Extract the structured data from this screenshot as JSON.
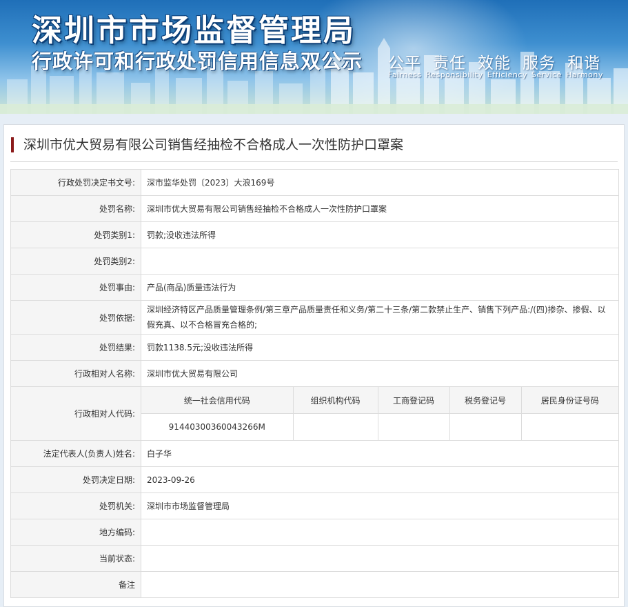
{
  "banner": {
    "title": "深圳市市场监督管理局",
    "subtitle": "行政许可和行政处罚信用信息双公示",
    "slogans": [
      "公平",
      "责任",
      "效能",
      "服务",
      "和谐"
    ],
    "slogans_en": [
      "Fairness",
      "Responsibility",
      "Efficiency",
      "Service",
      "Harmony"
    ]
  },
  "case_title": "深圳市优大贸易有限公司销售经抽检不合格成人一次性防护口罩案",
  "rows": {
    "doc_no": {
      "label": "行政处罚决定书文号:",
      "value": "深市监华处罚〔2023〕大浪169号"
    },
    "name": {
      "label": "处罚名称:",
      "value": "深圳市优大贸易有限公司销售经抽检不合格成人一次性防护口罩案"
    },
    "cat1": {
      "label": "处罚类别1:",
      "value": "罚款;没收违法所得"
    },
    "cat2": {
      "label": "处罚类别2:",
      "value": ""
    },
    "reason": {
      "label": "处罚事由:",
      "value": "产品(商品)质量违法行为"
    },
    "basis": {
      "label": "处罚依据:",
      "value": "深圳经济特区产品质量管理条例/第三章产品质量责任和义务/第二十三条/第二款禁止生产、销售下列产品:/(四)掺杂、掺假、以假充真、以不合格冒充合格的;"
    },
    "result": {
      "label": "处罚结果:",
      "value": "罚款1138.5元;没收违法所得"
    },
    "party": {
      "label": "行政相对人名称:",
      "value": "深圳市优大贸易有限公司"
    },
    "codes": {
      "label": "行政相对人代码:",
      "headers": [
        "统一社会信用代码",
        "组织机构代码",
        "工商登记码",
        "税务登记号",
        "居民身份证号码"
      ],
      "values": [
        "91440300360043266M",
        "",
        "",
        "",
        ""
      ]
    },
    "legal_rep": {
      "label": "法定代表人(负责人)姓名:",
      "value": "白子华"
    },
    "date": {
      "label": "处罚决定日期:",
      "value": "2023-09-26"
    },
    "authority": {
      "label": "处罚机关:",
      "value": "深圳市市场监督管理局"
    },
    "region": {
      "label": "地方编码:",
      "value": ""
    },
    "status": {
      "label": "当前状态:",
      "value": ""
    },
    "remark": {
      "label": "备注",
      "value": ""
    }
  }
}
